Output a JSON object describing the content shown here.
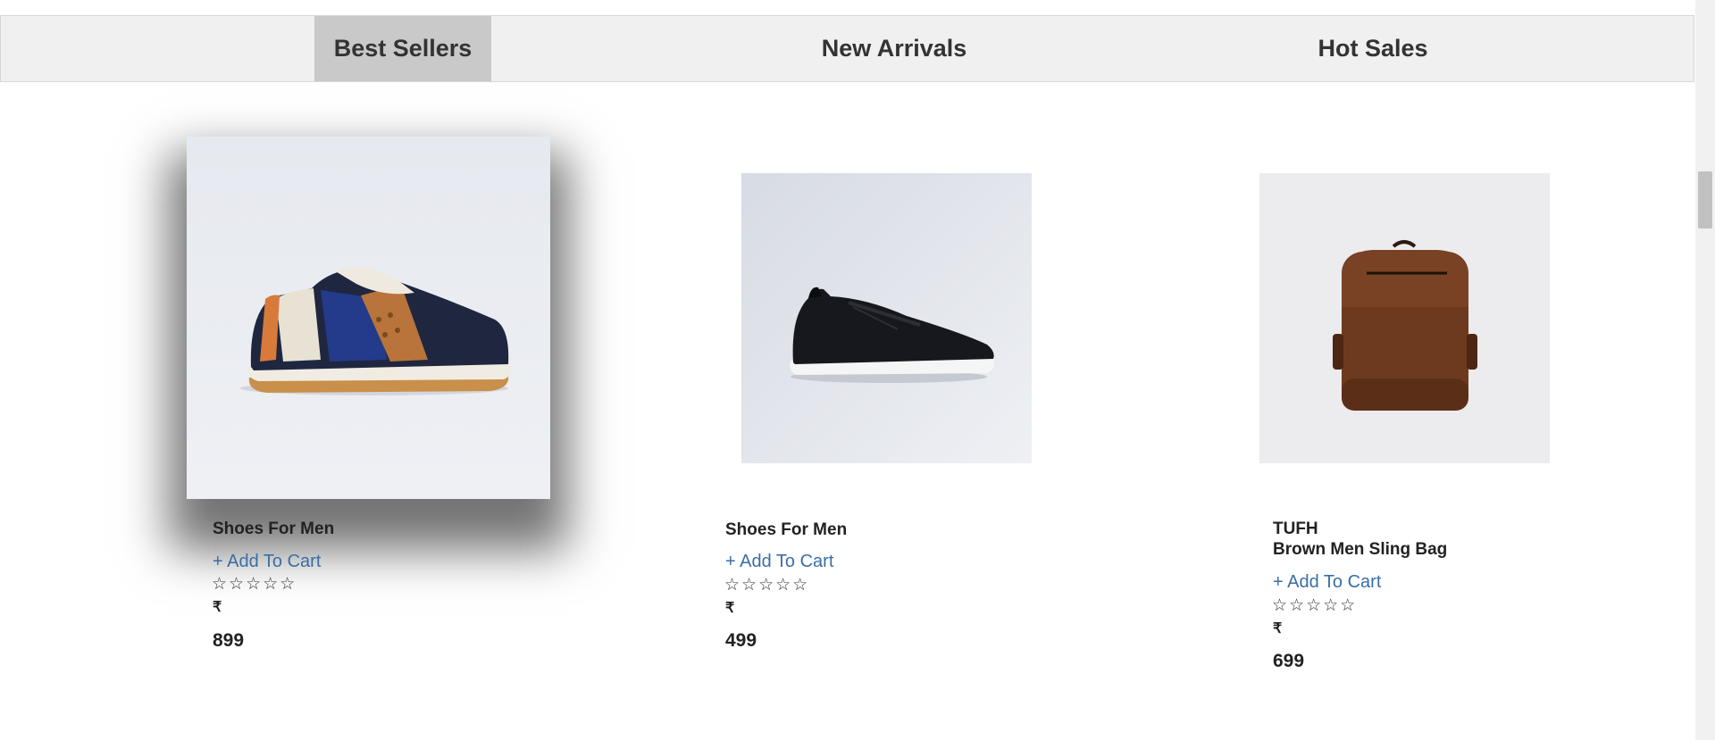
{
  "tabs": [
    {
      "label": "Best Sellers",
      "active": true
    },
    {
      "label": "New Arrivals",
      "active": false
    },
    {
      "label": "Hot Sales",
      "active": false
    }
  ],
  "products": [
    {
      "brand": "",
      "name": "Shoes For Men",
      "add_to_cart": "+ Add To Cart",
      "rating": 0,
      "currency": "₹",
      "price": "899",
      "image": "sneaker-navy-tan-icon"
    },
    {
      "brand": "",
      "name": "Shoes For Men",
      "add_to_cart": "+ Add To Cart",
      "rating": 0,
      "currency": "₹",
      "price": "499",
      "image": "sneaker-black-icon"
    },
    {
      "brand": "TUFH",
      "name": "Brown Men Sling Bag",
      "add_to_cart": "+ Add To Cart",
      "rating": 0,
      "currency": "₹",
      "price": "699",
      "image": "backpack-brown-icon"
    }
  ],
  "star_glyph": "☆☆☆☆☆",
  "colors": {
    "link": "#3a6ea5",
    "active_tab": "#c9c9c9",
    "tabbar": "#f0f0f0"
  }
}
